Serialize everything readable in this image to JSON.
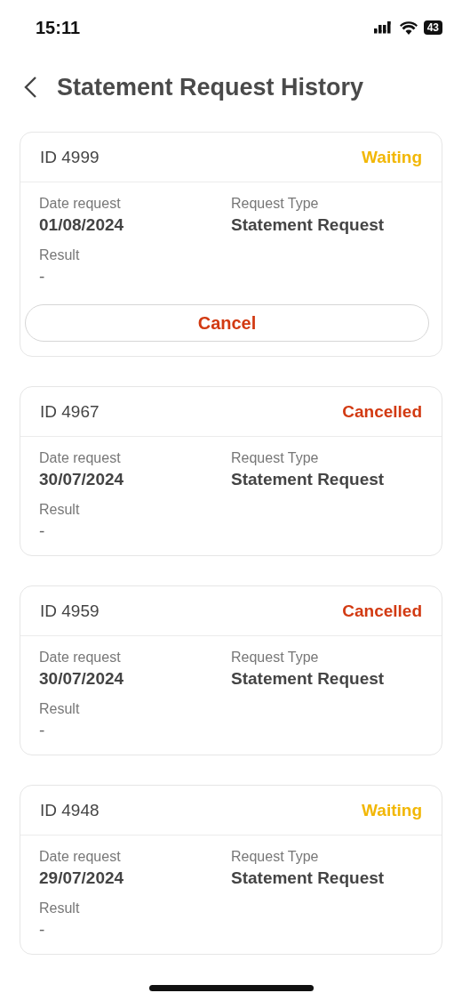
{
  "status_bar": {
    "time": "15:11",
    "battery": "43"
  },
  "header": {
    "title": "Statement Request History"
  },
  "requests": [
    {
      "id": "ID 4999",
      "status": "Waiting",
      "color": "#f2b705",
      "date_label": "Date request",
      "date": "01/08/2024",
      "type_label": "Request Type",
      "type": "Statement Request",
      "result_label": "Result",
      "result": "-",
      "action": "Cancel"
    },
    {
      "id": "ID 4967",
      "status": "Cancelled",
      "color": "#d23a12",
      "date_label": "Date request",
      "date": "30/07/2024",
      "type_label": "Request Type",
      "type": "Statement Request",
      "result_label": "Result",
      "result": "-"
    },
    {
      "id": "ID 4959",
      "status": "Cancelled",
      "color": "#d23a12",
      "date_label": "Date request",
      "date": "30/07/2024",
      "type_label": "Request Type",
      "type": "Statement Request",
      "result_label": "Result",
      "result": "-"
    },
    {
      "id": "ID 4948",
      "status": "Waiting",
      "color": "#f2b705",
      "date_label": "Date request",
      "date": "29/07/2024",
      "type_label": "Request Type",
      "type": "Statement Request",
      "result_label": "Result",
      "result": "-"
    }
  ]
}
